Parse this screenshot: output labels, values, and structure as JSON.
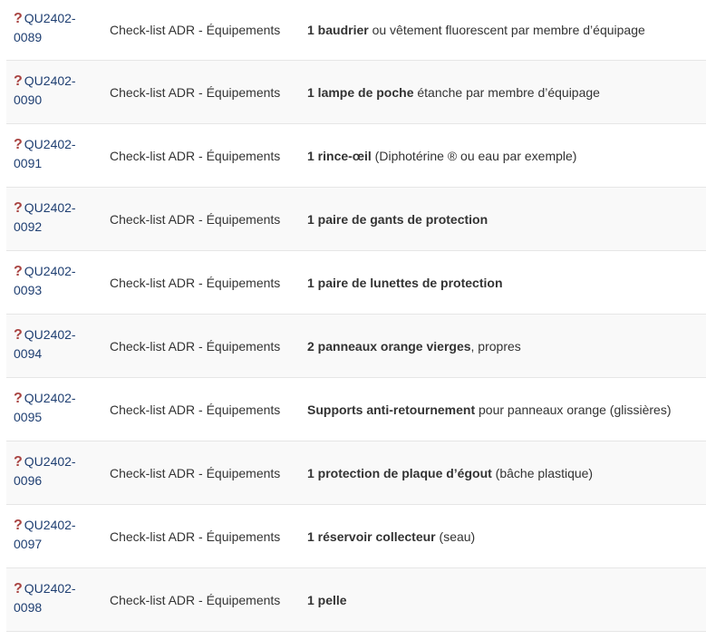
{
  "colors": {
    "code_link": "#1f3f72",
    "question_icon": "#a94442",
    "row_stripe": "#f9f9f9",
    "border": "#e6e6e6"
  },
  "rows": [
    {
      "code_a": "QU2402-",
      "code_b": "0089",
      "category": "Check-list ADR - Équipements",
      "bold": "1 baudrier",
      "rest": " ou vêtement fluorescent par membre d’équipage"
    },
    {
      "code_a": "QU2402-",
      "code_b": "0090",
      "category": "Check-list ADR - Équipements",
      "bold": "1 lampe de poche",
      "rest": " étanche par membre d’équipage"
    },
    {
      "code_a": "QU2402-",
      "code_b": "0091",
      "category": "Check-list ADR - Équipements",
      "bold": "1 rince-œil",
      "rest": " (Diphotérine ® ou eau par exemple)"
    },
    {
      "code_a": "QU2402-",
      "code_b": "0092",
      "category": "Check-list ADR - Équipements",
      "bold": "1 paire de gants de protection",
      "rest": ""
    },
    {
      "code_a": "QU2402-",
      "code_b": "0093",
      "category": "Check-list ADR - Équipements",
      "bold": "1 paire de lunettes de protection",
      "rest": ""
    },
    {
      "code_a": "QU2402-",
      "code_b": "0094",
      "category": "Check-list ADR - Équipements",
      "bold": "2 panneaux orange vierges",
      "rest": ", propres"
    },
    {
      "code_a": "QU2402-",
      "code_b": "0095",
      "category": "Check-list ADR - Équipements",
      "bold": "Supports anti-retournement",
      "rest": " pour panneaux orange (glissières)"
    },
    {
      "code_a": "QU2402-",
      "code_b": "0096",
      "category": "Check-list ADR - Équipements",
      "bold": "1 protection de plaque d’égout",
      "rest": " (bâche plastique)"
    },
    {
      "code_a": "QU2402-",
      "code_b": "0097",
      "category": "Check-list ADR - Équipements",
      "bold": "1 réservoir collecteur",
      "rest": " (seau)"
    },
    {
      "code_a": "QU2402-",
      "code_b": "0098",
      "category": "Check-list ADR - Équipements",
      "bold": "1 pelle",
      "rest": ""
    }
  ]
}
